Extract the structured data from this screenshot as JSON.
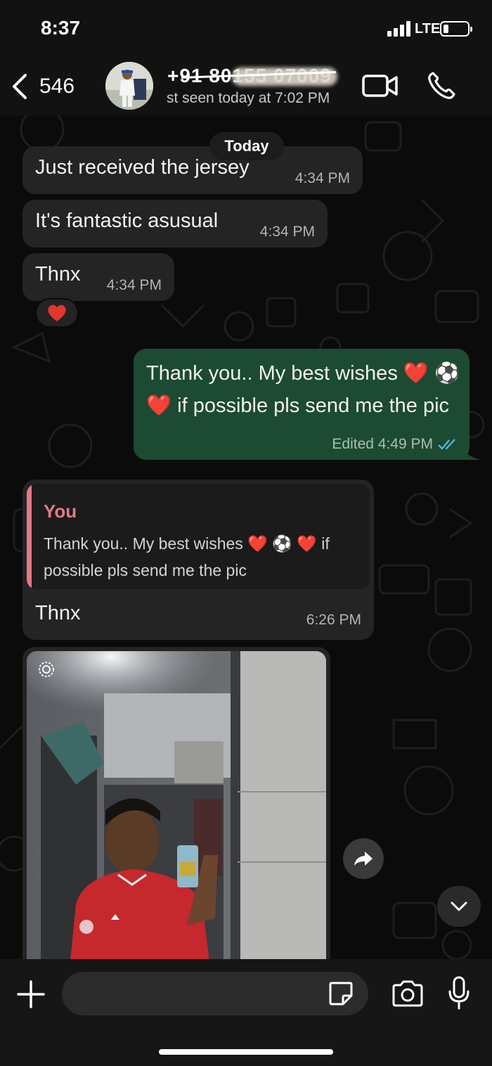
{
  "status_bar": {
    "time": "8:37",
    "network": "LTE",
    "signal_bars": 4,
    "battery_level": 0.2
  },
  "header": {
    "back_count": "546",
    "contact_name": "+91 80155 07009",
    "last_seen": "st seen today at 7:02 PM",
    "icons": [
      "back-chevron-icon",
      "video-camera-icon",
      "phone-icon"
    ]
  },
  "chat": {
    "date_chip": "Today",
    "incoming": [
      {
        "text": "Just received the jersey",
        "time": "4:34 PM"
      },
      {
        "text": "It's fantastic asusual",
        "time": "4:34 PM"
      },
      {
        "text": "Thnx",
        "time": "4:34 PM"
      }
    ],
    "reaction": "❤️",
    "outgoing": {
      "text": "Thank you.. My best wishes ❤️ ⚽ ❤️ if possible pls send me the pic",
      "meta": "Edited 4:49 PM",
      "read_status": "double-check-read-icon"
    },
    "reply_message": {
      "quote_author": "You",
      "quote_text": "Thank you.. My best wishes ❤️ ⚽ ❤️ if possible pls send me the pic",
      "text": "Thnx",
      "time": "6:26 PM"
    },
    "image_message": {
      "view_once_icon": "view-once-icon"
    }
  },
  "input_bar": {
    "placeholder": "",
    "icons": [
      "plus-icon",
      "sticker-icon",
      "camera-icon",
      "microphone-icon"
    ]
  },
  "colors": {
    "background": "#0b0b0b",
    "incoming_bubble": "#242424",
    "outgoing_bubble": "#1d4a32",
    "quote_accent": "#e27a8a",
    "read_ticks": "#53bdeb"
  }
}
